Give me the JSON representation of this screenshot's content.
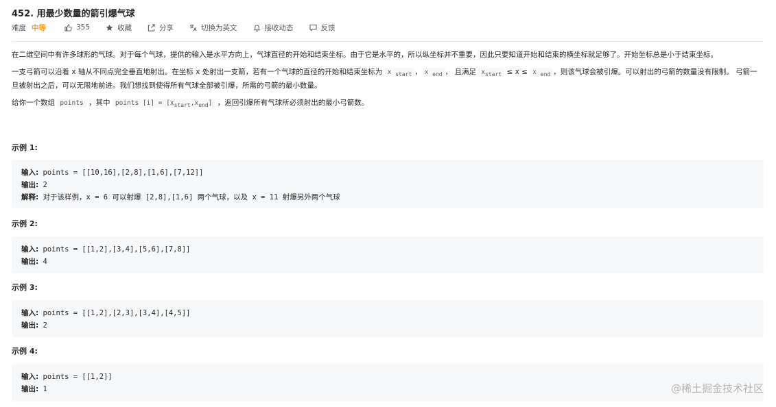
{
  "problem": {
    "title": "452. 用最少数量的箭引爆气球"
  },
  "meta": {
    "difficulty_label": "难度",
    "difficulty": "中等",
    "likes": "355",
    "favorite": "收藏",
    "share": "分享",
    "switch_lang": "切换为英文",
    "subscribe": "接收动态",
    "feedback": "反馈",
    "icons": [
      "thumbs-up-icon",
      "star-icon",
      "share-icon",
      "translate-icon",
      "bell-icon",
      "feedback-icon"
    ]
  },
  "description": {
    "p1": "在二维空间中有许多球形的气球。对于每个气球，提供的输入是水平方向上，气球直径的开始和结束坐标。由于它是水平的，所以纵坐标并不重要，因此只要知道开始和结束的横坐标就足够了。开始坐标总是小于结束坐标。",
    "p2_a": "一支弓箭可以沿着 x 轴从不同点完全垂直地射出。在坐标 x 处射出一支箭，若有一个气球的直径的开始和结束坐标为 ",
    "p2_code1": "x",
    "p2_sub1": "start",
    "p2_sep": "，",
    "p2_code2": "x",
    "p2_sub2": "end",
    "p2_b": "， 且满足 ",
    "p2_code3": "x",
    "p2_sub3": "start",
    "p2_c": " ≤ x ≤ ",
    "p2_code4": "x",
    "p2_sub4": "end",
    "p2_d": "，则该气球会被引爆。可以射出的弓箭的数量没有限制。 弓箭一旦被射出之后，可以无限地前进。我们想找到使得所有气球全部被引爆，所需的弓箭的最小数量。",
    "p3_a": "给你一个数组 ",
    "p3_code1": "points",
    "p3_b": " ，其中 ",
    "p3_code2": "points [i] = [x",
    "p3_sub_a": "start",
    "p3_code2b": ",x",
    "p3_sub_b": "end",
    "p3_code2c": "]",
    "p3_c": " ，返回引爆所有气球所必须射出的最小弓箭数。"
  },
  "examples": [
    {
      "title": "示例 1:",
      "input_label": "输入:",
      "input": " points = [[10,16],[2,8],[1,6],[7,12]]",
      "output_label": "输出:",
      "output": " 2",
      "explain_label": "解释:",
      "explain": " 对于该样例，x = 6 可以射爆 [2,8],[1,6] 两个气球，以及 x = 11 射爆另外两个气球"
    },
    {
      "title": "示例 2:",
      "input_label": "输入:",
      "input": " points = [[1,2],[3,4],[5,6],[7,8]]",
      "output_label": "输出:",
      "output": " 4"
    },
    {
      "title": "示例 3:",
      "input_label": "输入:",
      "input": " points = [[1,2],[2,3],[3,4],[4,5]]",
      "output_label": "输出:",
      "output": " 2"
    },
    {
      "title": "示例 4:",
      "input_label": "输入:",
      "input": " points = [[1,2]]",
      "output_label": "输出:",
      "output": " 1"
    }
  ],
  "watermark": "@稀土掘金技术社区",
  "colors": {
    "difficulty_medium": "#ffa116",
    "example_bg": "#f7f8fa",
    "code_bg": "#f7f7f7"
  }
}
